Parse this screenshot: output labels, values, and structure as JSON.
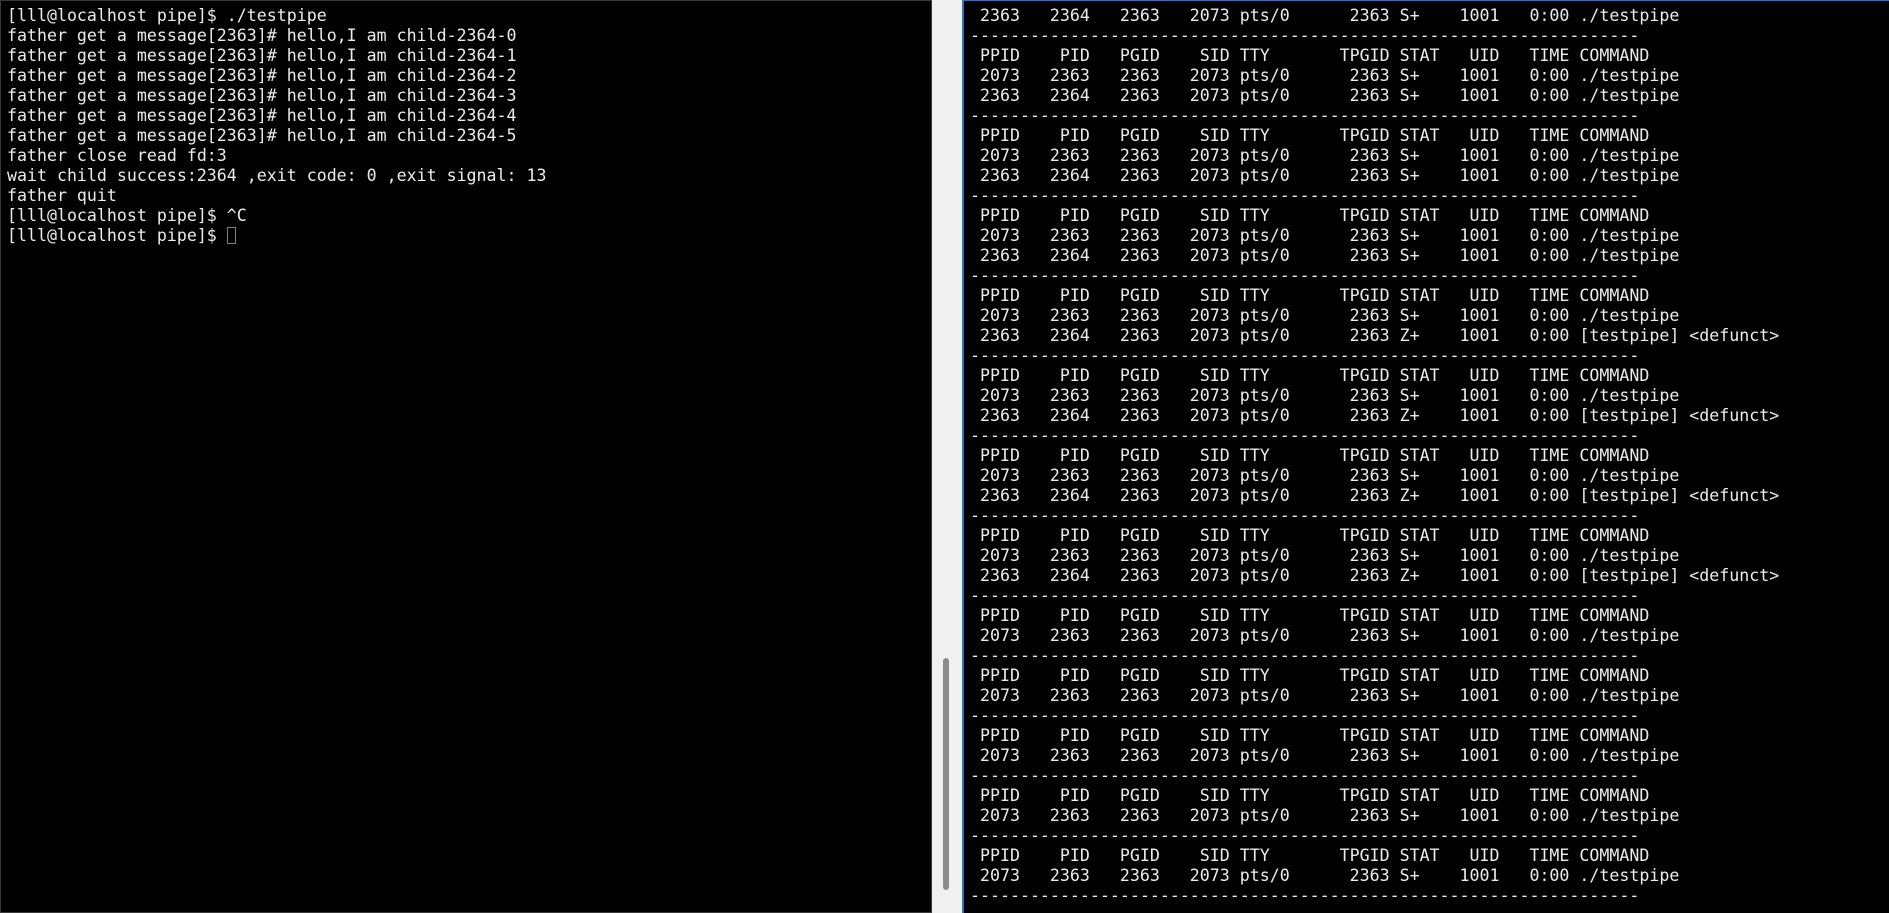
{
  "left_terminal": {
    "lines": [
      "[lll@localhost pipe]$ ./testpipe",
      "father get a message[2363]# hello,I am child-2364-0",
      "father get a message[2363]# hello,I am child-2364-1",
      "father get a message[2363]# hello,I am child-2364-2",
      "father get a message[2363]# hello,I am child-2364-3",
      "father get a message[2363]# hello,I am child-2364-4",
      "father get a message[2363]# hello,I am child-2364-5",
      "father close read fd:3",
      "wait child success:2364 ,exit code: 0 ,exit signal: 13",
      "father quit",
      "[lll@localhost pipe]$ ^C"
    ],
    "prompt": "[lll@localhost pipe]$ "
  },
  "right_terminal": {
    "header": " PPID    PID   PGID    SID TTY       TPGID STAT   UID   TIME COMMAND",
    "separator": "-------------------------------------------------------------------",
    "first_row": " 2363   2364   2363   2073 pts/0      2363 S+    1001   0:00 ./testpipe",
    "blocks": [
      {
        "rows": [
          " 2073   2363   2363   2073 pts/0      2363 S+    1001   0:00 ./testpipe",
          " 2363   2364   2363   2073 pts/0      2363 S+    1001   0:00 ./testpipe"
        ]
      },
      {
        "rows": [
          " 2073   2363   2363   2073 pts/0      2363 S+    1001   0:00 ./testpipe",
          " 2363   2364   2363   2073 pts/0      2363 S+    1001   0:00 ./testpipe"
        ]
      },
      {
        "rows": [
          " 2073   2363   2363   2073 pts/0      2363 S+    1001   0:00 ./testpipe",
          " 2363   2364   2363   2073 pts/0      2363 S+    1001   0:00 ./testpipe"
        ]
      },
      {
        "rows": [
          " 2073   2363   2363   2073 pts/0      2363 S+    1001   0:00 ./testpipe",
          " 2363   2364   2363   2073 pts/0      2363 Z+    1001   0:00 [testpipe] <defunct>"
        ]
      },
      {
        "rows": [
          " 2073   2363   2363   2073 pts/0      2363 S+    1001   0:00 ./testpipe",
          " 2363   2364   2363   2073 pts/0      2363 Z+    1001   0:00 [testpipe] <defunct>"
        ]
      },
      {
        "rows": [
          " 2073   2363   2363   2073 pts/0      2363 S+    1001   0:00 ./testpipe",
          " 2363   2364   2363   2073 pts/0      2363 Z+    1001   0:00 [testpipe] <defunct>"
        ]
      },
      {
        "rows": [
          " 2073   2363   2363   2073 pts/0      2363 S+    1001   0:00 ./testpipe",
          " 2363   2364   2363   2073 pts/0      2363 Z+    1001   0:00 [testpipe] <defunct>"
        ]
      },
      {
        "rows": [
          " 2073   2363   2363   2073 pts/0      2363 S+    1001   0:00 ./testpipe"
        ]
      },
      {
        "rows": [
          " 2073   2363   2363   2073 pts/0      2363 S+    1001   0:00 ./testpipe"
        ]
      },
      {
        "rows": [
          " 2073   2363   2363   2073 pts/0      2363 S+    1001   0:00 ./testpipe"
        ]
      },
      {
        "rows": [
          " 2073   2363   2363   2073 pts/0      2363 S+    1001   0:00 ./testpipe"
        ]
      },
      {
        "rows": [
          " 2073   2363   2363   2073 pts/0      2363 S+    1001   0:00 ./testpipe"
        ]
      }
    ]
  },
  "colors": {
    "background": "#000000",
    "text": "#ececec",
    "cursor": "#22c022",
    "active_border": "#3b6fb6"
  }
}
